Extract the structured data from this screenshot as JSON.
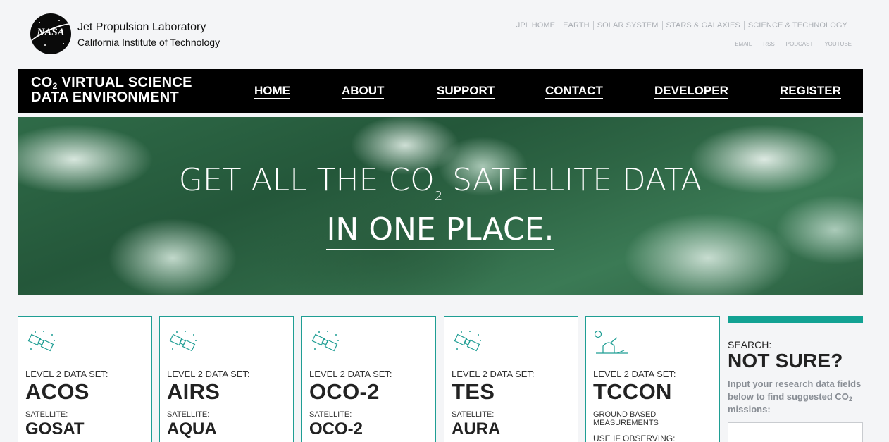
{
  "header": {
    "org_name": "Jet Propulsion Laboratory",
    "org_sub": "California Institute of Technology",
    "logo_word": "NASA",
    "top_links": [
      "JPL HOME",
      "EARTH",
      "SOLAR SYSTEM",
      "STARS & GALAXIES",
      "SCIENCE & TECHNOLOGY"
    ],
    "sub_links": [
      "EMAIL",
      "RSS",
      "PODCAST",
      "YOUTUBE"
    ]
  },
  "navbar": {
    "title_prefix": "CO",
    "title_subscript": "2",
    "title_rest_line1": " VIRTUAL SCIENCE",
    "title_line2": "DATA ENVIRONMENT",
    "items": [
      "HOME",
      "ABOUT",
      "SUPPORT",
      "CONTACT",
      "DEVELOPER",
      "REGISTER"
    ]
  },
  "hero": {
    "line1_a": "GET ALL THE CO",
    "line1_sub": "2",
    "line1_b": " SATELLITE DATA",
    "line2": "IN ONE PLACE."
  },
  "cards": [
    {
      "level_label": "LEVEL 2 DATA SET:",
      "level_value": "ACOS",
      "sat_label": "SATELLITE:",
      "sat_value": "GOSAT",
      "icon": "satellite-icon"
    },
    {
      "level_label": "LEVEL 2 DATA SET:",
      "level_value": "AIRS",
      "sat_label": "SATELLITE:",
      "sat_value": "AQUA",
      "icon": "satellite-icon"
    },
    {
      "level_label": "LEVEL 2 DATA SET:",
      "level_value": "OCO-2",
      "sat_label": "SATELLITE:",
      "sat_value": "OCO-2",
      "icon": "satellite-icon"
    },
    {
      "level_label": "LEVEL 2 DATA SET:",
      "level_value": "TES",
      "sat_label": "SATELLITE:",
      "sat_value": "AURA",
      "icon": "satellite-icon"
    },
    {
      "level_label": "LEVEL 2 DATA SET:",
      "level_value": "TCCON",
      "ground_label": "GROUND BASED MEASUREMENTS",
      "use_if": "USE IF OBSERVING:",
      "icon": "observatory-icon"
    }
  ],
  "search": {
    "label": "SEARCH:",
    "title": "NOT SURE?",
    "desc_a": "Input your research data fields below to find suggested CO",
    "desc_sub": "2",
    "desc_b": " missions:",
    "input_value": ""
  },
  "colors": {
    "accent": "#12a293",
    "card_border": "#1f9e94",
    "navbar_bg": "#000000",
    "page_bg": "#f4f5f7"
  }
}
